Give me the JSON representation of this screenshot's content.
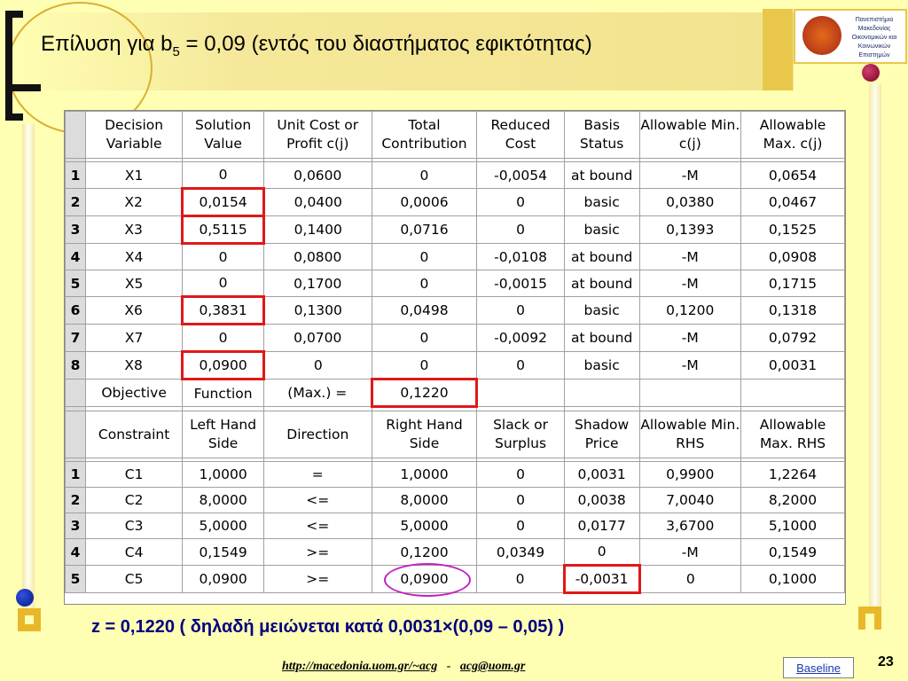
{
  "title": {
    "prefix": "Επίλυση για b",
    "sub": "5",
    "suffix": " = 0,09 (εντός του διαστήματος εφικτότητας)"
  },
  "logo": {
    "text": "Πανεπιστήμιο Μακεδονίας Οικονομικών και Κοινωνικών Επιστημών"
  },
  "table": {
    "header1": [
      "Decision Variable",
      "Solution Value",
      "Unit Cost or Profit c(j)",
      "Total Contribution",
      "Reduced Cost",
      "Basis Status",
      "Allowable Min. c(j)",
      "Allowable Max. c(j)"
    ],
    "rows1": [
      {
        "n": "1",
        "cells": [
          "X1",
          "0",
          "0,0600",
          "0",
          "-0,0054",
          "at bound",
          "-M",
          "0,0654"
        ]
      },
      {
        "n": "2",
        "cells": [
          "X2",
          "0,0154",
          "0,0400",
          "0,0006",
          "0",
          "basic",
          "0,0380",
          "0,0467"
        ]
      },
      {
        "n": "3",
        "cells": [
          "X3",
          "0,5115",
          "0,1400",
          "0,0716",
          "0",
          "basic",
          "0,1393",
          "0,1525"
        ]
      },
      {
        "n": "4",
        "cells": [
          "X4",
          "0",
          "0,0800",
          "0",
          "-0,0108",
          "at bound",
          "-M",
          "0,0908"
        ]
      },
      {
        "n": "5",
        "cells": [
          "X5",
          "0",
          "0,1700",
          "0",
          "-0,0015",
          "at bound",
          "-M",
          "0,1715"
        ]
      },
      {
        "n": "6",
        "cells": [
          "X6",
          "0,3831",
          "0,1300",
          "0,0498",
          "0",
          "basic",
          "0,1200",
          "0,1318"
        ]
      },
      {
        "n": "7",
        "cells": [
          "X7",
          "0",
          "0,0700",
          "0",
          "-0,0092",
          "at bound",
          "-M",
          "0,0792"
        ]
      },
      {
        "n": "8",
        "cells": [
          "X8",
          "0,0900",
          "0",
          "0",
          "0",
          "basic",
          "-M",
          "0,0031"
        ]
      }
    ],
    "objective": [
      "Objective",
      "Function",
      "(Max.) =",
      "0,1220"
    ],
    "header2": [
      "Constraint",
      "Left Hand Side",
      "Direction",
      "Right Hand Side",
      "Slack or Surplus",
      "Shadow Price",
      "Allowable Min. RHS",
      "Allowable Max. RHS"
    ],
    "rows2": [
      {
        "n": "1",
        "cells": [
          "C1",
          "1,0000",
          "=",
          "1,0000",
          "0",
          "0,0031",
          "0,9900",
          "1,2264"
        ]
      },
      {
        "n": "2",
        "cells": [
          "C2",
          "8,0000",
          "<=",
          "8,0000",
          "0",
          "0,0038",
          "7,0040",
          "8,2000"
        ]
      },
      {
        "n": "3",
        "cells": [
          "C3",
          "5,0000",
          "<=",
          "5,0000",
          "0",
          "0,0177",
          "3,6700",
          "5,1000"
        ]
      },
      {
        "n": "4",
        "cells": [
          "C4",
          "0,1549",
          ">=",
          "0,1200",
          "0,0349",
          "0",
          "-M",
          "0,1549"
        ]
      },
      {
        "n": "5",
        "cells": [
          "C5",
          "0,0900",
          ">=",
          "0,0900",
          "0",
          "-0,0031",
          "0",
          "0,1000"
        ]
      }
    ]
  },
  "result_line": "z = 0,1220 ( δηλαδή μειώνεται κατά 0,0031×(0,09 – 0,05) )",
  "footer": {
    "url": "http://macedonia.uom.gr/~acg",
    "sep": "-",
    "email": "acg@uom.gr"
  },
  "baseline_label": "Baseline",
  "page_number": "23",
  "colors": {
    "background": "#ffffb4",
    "highlight_red": "#e01818",
    "highlight_oval": "#c020c0",
    "accent_gold": "#e8b82a",
    "text_blue": "#000080"
  }
}
